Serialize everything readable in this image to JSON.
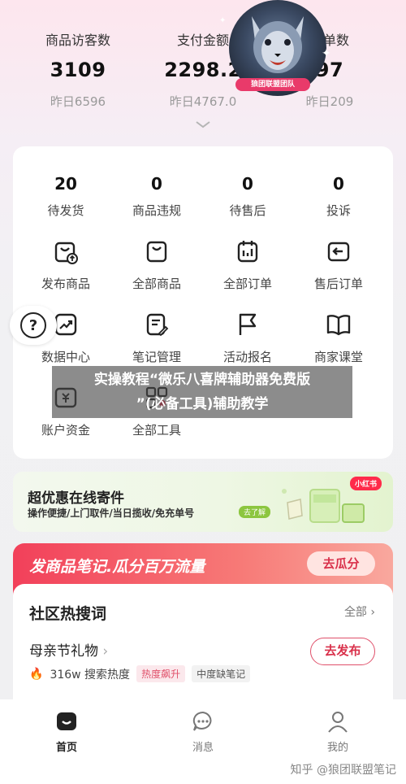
{
  "stats": [
    {
      "label": "商品访客数",
      "value": "3109",
      "prev": "昨日6596"
    },
    {
      "label": "支付金额",
      "value": "2298.2",
      "prev": "昨日4767.0"
    },
    {
      "label": "订单数",
      "value": "97",
      "prev": "昨日209"
    }
  ],
  "avatar": {
    "tag": "狼团联盟团队"
  },
  "counts": [
    {
      "value": "20",
      "label": "待发货"
    },
    {
      "value": "0",
      "label": "商品违规"
    },
    {
      "value": "0",
      "label": "待售后"
    },
    {
      "value": "0",
      "label": "投诉"
    }
  ],
  "tools": [
    {
      "label": "发布商品",
      "icon": "bag-upload-icon"
    },
    {
      "label": "全部商品",
      "icon": "bag-icon"
    },
    {
      "label": "全部订单",
      "icon": "clipboard-icon"
    },
    {
      "label": "售后订单",
      "icon": "return-icon"
    },
    {
      "label": "数据中心",
      "icon": "trend-chart-icon"
    },
    {
      "label": "笔记管理",
      "icon": "note-edit-icon"
    },
    {
      "label": "活动报名",
      "icon": "flag-icon"
    },
    {
      "label": "商家课堂",
      "icon": "book-icon"
    },
    {
      "label": "账户资金",
      "icon": "wallet-icon"
    },
    {
      "label": "全部工具",
      "icon": "tools-grid-icon"
    }
  ],
  "overlay": {
    "line1": "实操教程“微乐八喜牌辅助器免费版",
    "line2": "”(必备工具)辅助教学"
  },
  "express": {
    "title": "超优惠在线寄件",
    "subtitle": "操作便捷/上门取件/当日揽收/免充单号",
    "go": "去了解",
    "badge": "小红书"
  },
  "promo": {
    "title": "发商品笔记.瓜分百万流量",
    "button": "去瓜分"
  },
  "hot": {
    "title": "社区热搜词",
    "all": "全部",
    "topic": "母亲节礼物",
    "heat": "316w 搜索热度",
    "tag1": "热度飙升",
    "tag2": "中度缺笔记",
    "publish": "去发布"
  },
  "nav": [
    {
      "label": "首页",
      "icon": "home-icon",
      "active": true
    },
    {
      "label": "消息",
      "icon": "message-icon",
      "active": false
    },
    {
      "label": "我的",
      "icon": "profile-icon",
      "active": false
    }
  ],
  "watermark": "知乎 @狼团联盟笔记",
  "colors": {
    "accent": "#e0506a",
    "brand_red": "#ff2b4a",
    "green": "#8cc63f"
  }
}
